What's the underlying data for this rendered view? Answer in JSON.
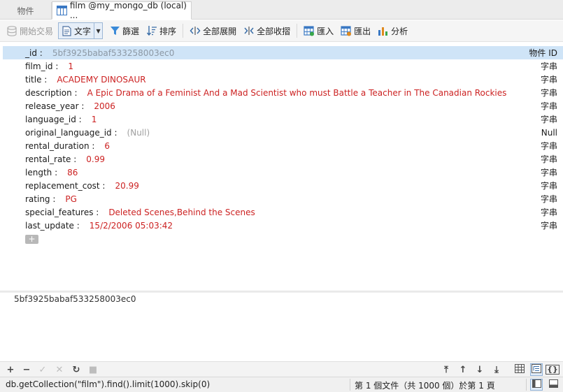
{
  "tabs": {
    "objects": "物件",
    "active": "film @my_mongo_db (local) ..."
  },
  "toolbar": {
    "begin_transaction": "開始交易",
    "text": "文字",
    "filter": "篩選",
    "sort": "排序",
    "expand_all": "全部展開",
    "collapse_all": "全部收摺",
    "import": "匯入",
    "export": "匯出",
    "analyze": "分析"
  },
  "document": {
    "fields": [
      {
        "key": "_id :",
        "value": "5bf3925babaf533258003ec0",
        "type": "物件 ID"
      },
      {
        "key": "film_id :",
        "value": "1",
        "type": "字串"
      },
      {
        "key": "title :",
        "value": "ACADEMY DINOSAUR",
        "type": "字串"
      },
      {
        "key": "description :",
        "value": "A Epic Drama of a Feminist And a Mad Scientist who must Battle a Teacher in The Canadian Rockies",
        "type": "字串"
      },
      {
        "key": "release_year :",
        "value": "2006",
        "type": "字串"
      },
      {
        "key": "language_id :",
        "value": "1",
        "type": "字串"
      },
      {
        "key": "original_language_id :",
        "value": "(Null)",
        "type": "Null"
      },
      {
        "key": "rental_duration :",
        "value": "6",
        "type": "字串"
      },
      {
        "key": "rental_rate :",
        "value": "0.99",
        "type": "字串"
      },
      {
        "key": "length :",
        "value": "86",
        "type": "字串"
      },
      {
        "key": "replacement_cost :",
        "value": "20.99",
        "type": "字串"
      },
      {
        "key": "rating :",
        "value": "PG",
        "type": "字串"
      },
      {
        "key": "special_features :",
        "value": "Deleted Scenes,Behind the Scenes",
        "type": "字串"
      },
      {
        "key": "last_update :",
        "value": "15/2/2006 05:03:42",
        "type": "字串"
      }
    ],
    "add_button": "+"
  },
  "preview": {
    "value": "5bf3925babaf533258003ec0"
  },
  "statusbar": {
    "query": "db.getCollection(\"film\").find().limit(1000).skip(0)",
    "status": "第 1 個文件（共 1000 個）於第 1 頁"
  },
  "colors": {
    "value_text": "#cc2222",
    "selected_row": "#cfe4f7",
    "accent": "#3a78c3"
  }
}
